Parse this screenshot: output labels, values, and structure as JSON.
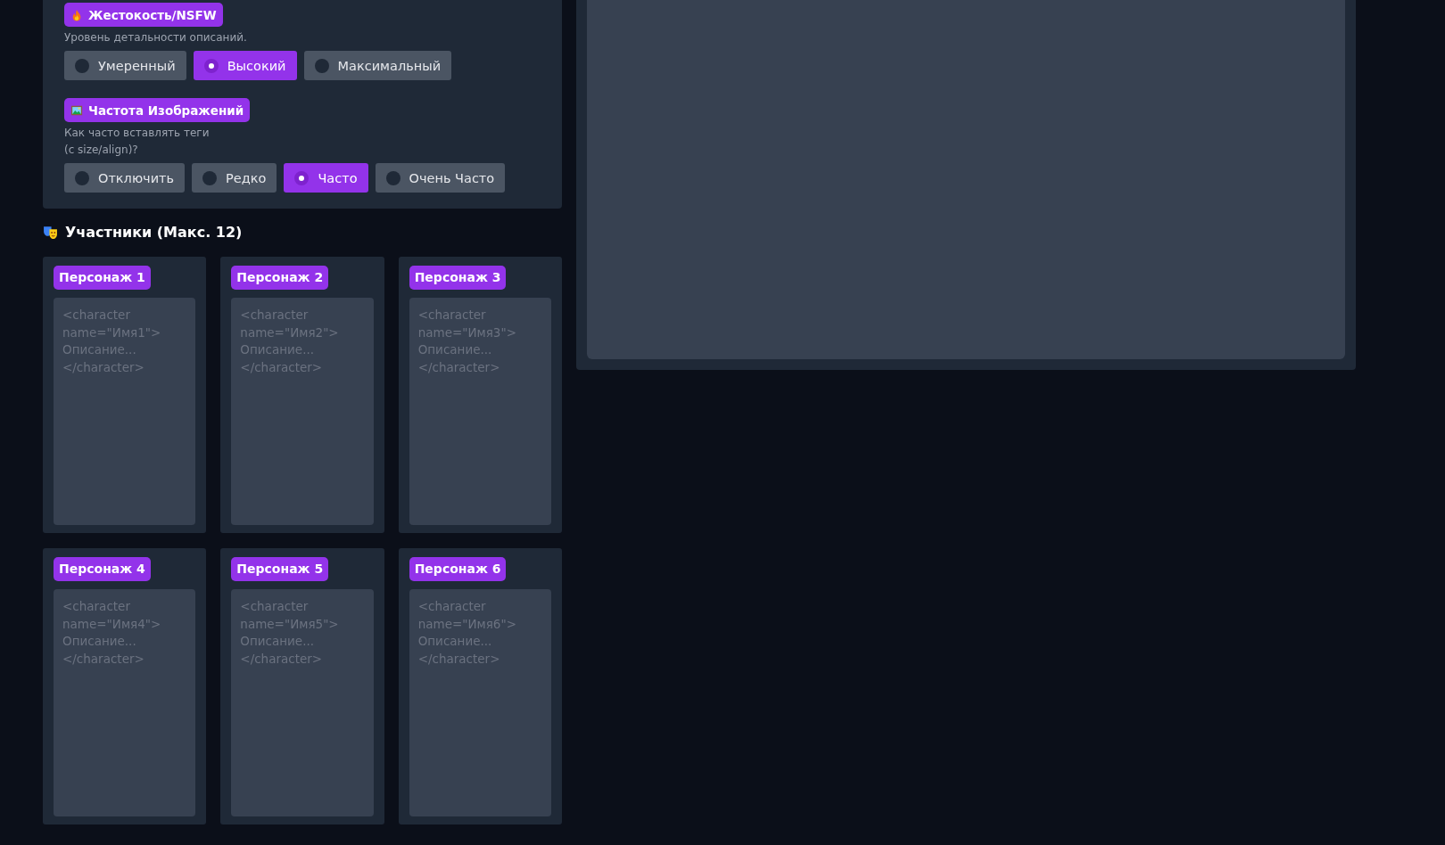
{
  "settings": [
    {
      "kind": "radio",
      "title": "Жестокость/NSFW",
      "hint": "Уровень детальности описаний.",
      "options": [
        {
          "label": "Умеренный",
          "selected": false
        },
        {
          "label": "Высокий",
          "selected": true
        },
        {
          "label": "Максимальный",
          "selected": false
        }
      ]
    },
    {
      "kind": "radio",
      "title": "Частота Изображений",
      "hint": "Как часто вставлять теги\n(с size/align)?",
      "options": [
        {
          "label": "Отключить",
          "selected": false
        },
        {
          "label": "Редко",
          "selected": false
        },
        {
          "label": "Часто",
          "selected": true
        },
        {
          "label": "Очень Часто",
          "selected": false
        }
      ]
    }
  ],
  "participants": {
    "title": "Участники (Макс. 12)",
    "characters": [
      {
        "label": "Персонаж 1",
        "placeholder": "<character\nname=\"Имя1\">\nОписание...\n</character>"
      },
      {
        "label": "Персонаж 2",
        "placeholder": "<character\nname=\"Имя2\">\nОписание...\n</character>"
      },
      {
        "label": "Персонаж 3",
        "placeholder": "<character\nname=\"Имя3\">\nОписание...\n</character>"
      },
      {
        "label": "Персонаж 4",
        "placeholder": "<character\nname=\"Имя4\">\nОписание...\n</character>"
      },
      {
        "label": "Персонаж 5",
        "placeholder": "<character\nname=\"Имя5\">\nОписание...\n</character>"
      },
      {
        "label": "Персонаж 6",
        "placeholder": "<character\nname=\"Имя6\">\nОписание...\n</character>"
      }
    ]
  }
}
